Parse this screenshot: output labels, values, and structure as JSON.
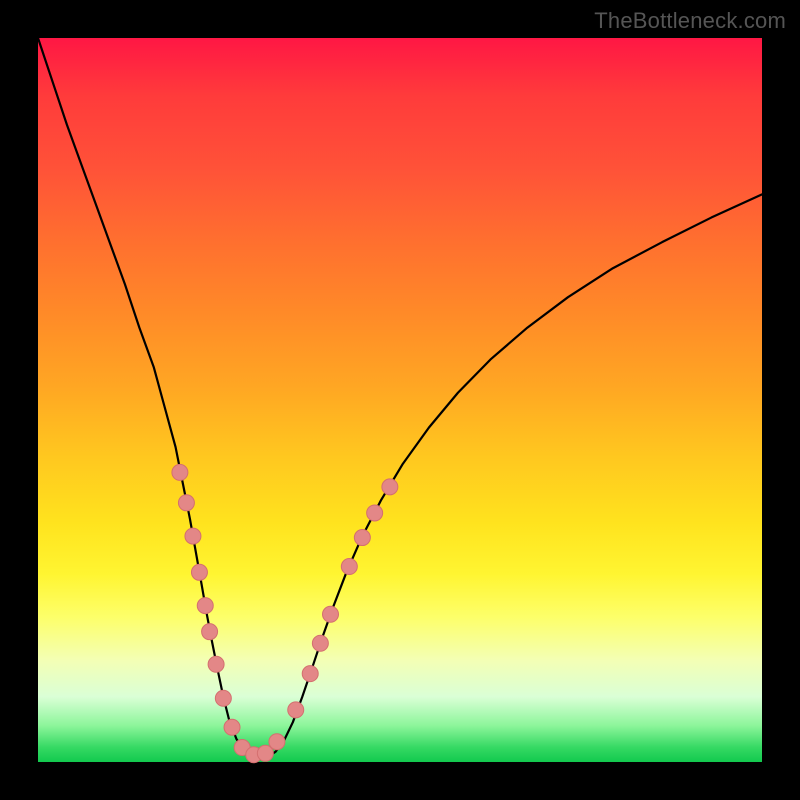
{
  "watermark": "TheBottleneck.com",
  "chart_data": {
    "type": "line",
    "title": "",
    "xlabel": "",
    "ylabel": "",
    "xlim": [
      0,
      1
    ],
    "ylim": [
      0,
      1
    ],
    "curve": {
      "comment": "Black V-shaped curve resembling a bottleneck plot. x normalized 0..1 left→right, y normalized 0..1 bottom→top. Points are (x, y).",
      "points": [
        [
          0.0,
          1.0
        ],
        [
          0.02,
          0.94
        ],
        [
          0.04,
          0.88
        ],
        [
          0.06,
          0.825
        ],
        [
          0.08,
          0.77
        ],
        [
          0.1,
          0.715
        ],
        [
          0.12,
          0.66
        ],
        [
          0.14,
          0.6
        ],
        [
          0.16,
          0.545
        ],
        [
          0.175,
          0.49
        ],
        [
          0.19,
          0.435
        ],
        [
          0.2,
          0.385
        ],
        [
          0.21,
          0.335
        ],
        [
          0.218,
          0.29
        ],
        [
          0.226,
          0.245
        ],
        [
          0.233,
          0.205
        ],
        [
          0.24,
          0.168
        ],
        [
          0.248,
          0.128
        ],
        [
          0.256,
          0.09
        ],
        [
          0.264,
          0.058
        ],
        [
          0.274,
          0.032
        ],
        [
          0.286,
          0.014
        ],
        [
          0.3,
          0.005
        ],
        [
          0.314,
          0.005
        ],
        [
          0.328,
          0.014
        ],
        [
          0.34,
          0.03
        ],
        [
          0.352,
          0.055
        ],
        [
          0.365,
          0.09
        ],
        [
          0.378,
          0.128
        ],
        [
          0.392,
          0.17
        ],
        [
          0.408,
          0.215
        ],
        [
          0.426,
          0.262
        ],
        [
          0.448,
          0.312
        ],
        [
          0.474,
          0.362
        ],
        [
          0.504,
          0.412
        ],
        [
          0.54,
          0.462
        ],
        [
          0.58,
          0.51
        ],
        [
          0.625,
          0.556
        ],
        [
          0.676,
          0.6
        ],
        [
          0.732,
          0.642
        ],
        [
          0.794,
          0.682
        ],
        [
          0.862,
          0.718
        ],
        [
          0.93,
          0.752
        ],
        [
          1.0,
          0.784
        ]
      ]
    },
    "series": [
      {
        "name": "markers",
        "color": "#e57373",
        "radius": 8,
        "points": [
          [
            0.196,
            0.4
          ],
          [
            0.205,
            0.358
          ],
          [
            0.214,
            0.312
          ],
          [
            0.223,
            0.262
          ],
          [
            0.231,
            0.216
          ],
          [
            0.237,
            0.18
          ],
          [
            0.246,
            0.135
          ],
          [
            0.256,
            0.088
          ],
          [
            0.268,
            0.048
          ],
          [
            0.282,
            0.02
          ],
          [
            0.298,
            0.01
          ],
          [
            0.314,
            0.012
          ],
          [
            0.33,
            0.028
          ],
          [
            0.356,
            0.072
          ],
          [
            0.376,
            0.122
          ],
          [
            0.39,
            0.164
          ],
          [
            0.404,
            0.204
          ],
          [
            0.43,
            0.27
          ],
          [
            0.448,
            0.31
          ],
          [
            0.465,
            0.344
          ],
          [
            0.486,
            0.38
          ]
        ]
      }
    ]
  },
  "colors": {
    "curve": "#000000",
    "marker_fill": "#e38787",
    "marker_stroke": "#d46f6f"
  }
}
